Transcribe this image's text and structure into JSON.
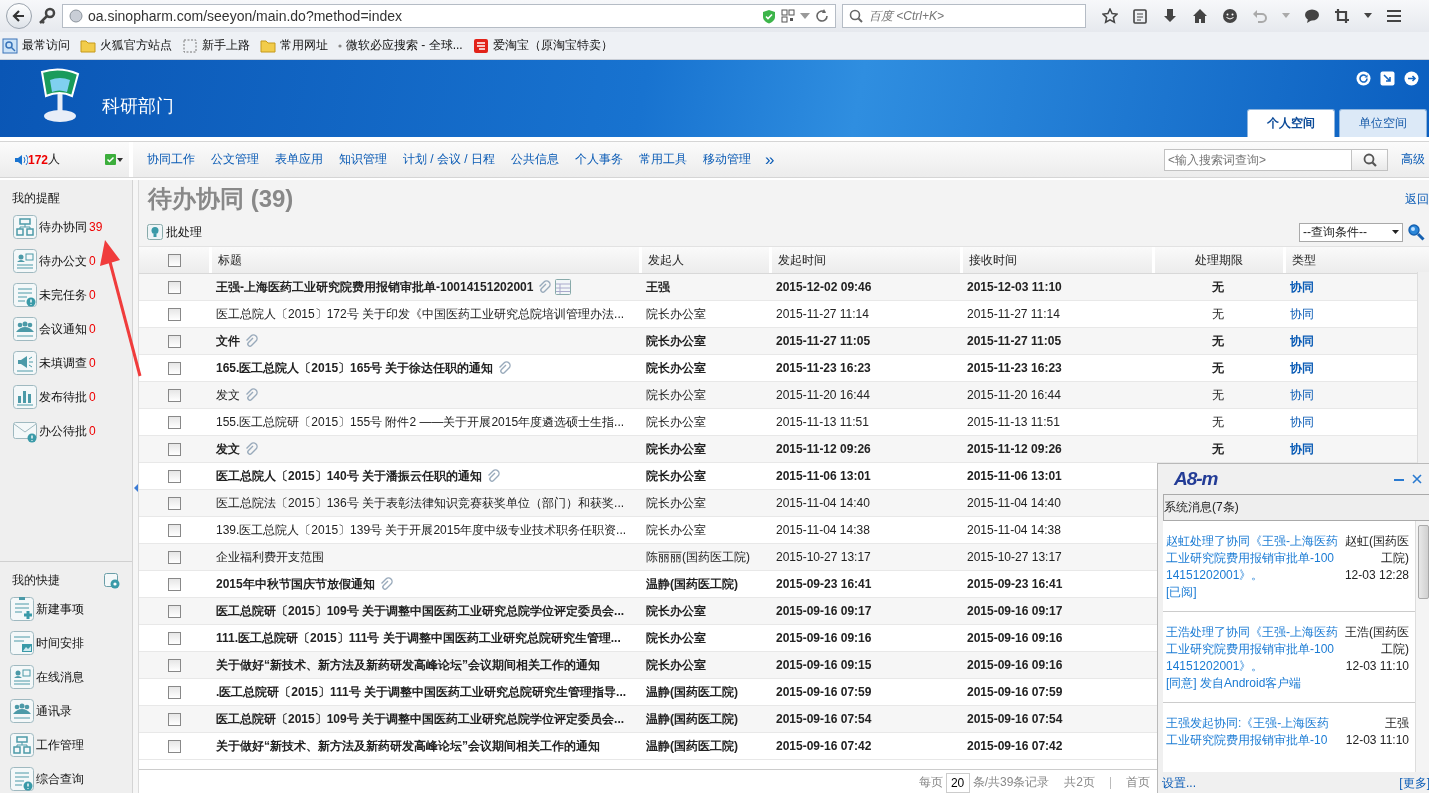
{
  "browser": {
    "url": "oa.sinopharm.com/seeyon/main.do?method=index",
    "search_placeholder": "百度 <Ctrl+K>",
    "bookmarks": [
      {
        "label": "最常访问",
        "kind": "recent"
      },
      {
        "label": "火狐官方站点",
        "kind": "folder"
      },
      {
        "label": "新手上路",
        "kind": "page"
      },
      {
        "label": "常用网址",
        "kind": "folder"
      },
      {
        "label": "微软必应搜索 - 全球...",
        "kind": "bing"
      },
      {
        "label": "爱淘宝（原淘宝特卖）",
        "kind": "shop"
      }
    ]
  },
  "header": {
    "title": "科研部门",
    "tabs": [
      {
        "label": "个人空间",
        "selected": true
      },
      {
        "label": "单位空间",
        "selected": false
      }
    ]
  },
  "navbar": {
    "online_count": "172",
    "online_unit": "人",
    "items": [
      "协同工作",
      "公文管理",
      "表单应用",
      "知识管理",
      "计划 / 会议 / 日程",
      "公共信息",
      "个人事务",
      "常用工具",
      "移动管理"
    ],
    "more": "»",
    "search_placeholder": "<输入搜索词查询>",
    "advanced": "高级"
  },
  "sidebar": {
    "reminders_title": "我的提醒",
    "reminders": [
      {
        "label": "待办协同",
        "count": "39"
      },
      {
        "label": "待办公文",
        "count": "0"
      },
      {
        "label": "未完任务",
        "count": "0"
      },
      {
        "label": "会议通知",
        "count": "0"
      },
      {
        "label": "未填调查",
        "count": "0"
      },
      {
        "label": "发布待批",
        "count": "0"
      },
      {
        "label": "办公待批",
        "count": "0"
      }
    ],
    "shortcuts_title": "我的快捷",
    "shortcuts": [
      "新建事项",
      "时间安排",
      "在线消息",
      "通讯录",
      "工作管理",
      "综合查询"
    ]
  },
  "main": {
    "title": "待办协同 (39)",
    "back": "返回",
    "batch": "批处理",
    "query_select": "--查询条件--"
  },
  "table": {
    "columns": [
      "标题",
      "发起人",
      "发起时间",
      "接收时间",
      "处理期限",
      "类型"
    ],
    "header_checked": false,
    "rows": [
      {
        "title": "王强-上海医药工业研究院费用报销审批单-10014151202001",
        "sender": "王强",
        "start": "2015-12-02 09:46",
        "received": "2015-12-03 11:10",
        "deadline": "无",
        "type": "协同",
        "unread": true,
        "attachment": true,
        "form": true,
        "checked": false
      },
      {
        "title": "医工总院人〔2015〕172号 关于印发《中国医药工业研究总院培训管理办法...",
        "sender": "院长办公室",
        "start": "2015-11-27 11:14",
        "received": "2015-11-27 11:14",
        "deadline": "无",
        "type": "协同",
        "unread": false,
        "attachment": false,
        "form": false,
        "checked": false
      },
      {
        "title": "文件",
        "sender": "院长办公室",
        "start": "2015-11-27 11:05",
        "received": "2015-11-27 11:05",
        "deadline": "无",
        "type": "协同",
        "unread": true,
        "attachment": true,
        "form": false,
        "checked": false
      },
      {
        "title": "165.医工总院人〔2015〕165号 关于徐达任职的通知",
        "sender": "院长办公室",
        "start": "2015-11-23 16:23",
        "received": "2015-11-23 16:23",
        "deadline": "无",
        "type": "协同",
        "unread": true,
        "attachment": true,
        "form": false,
        "checked": false
      },
      {
        "title": "发文",
        "sender": "院长办公室",
        "start": "2015-11-20 16:44",
        "received": "2015-11-20 16:44",
        "deadline": "无",
        "type": "协同",
        "unread": false,
        "attachment": true,
        "form": false,
        "checked": false
      },
      {
        "title": "155.医工总院研〔2015〕155号 附件2 ——关于开展2015年度遴选硕士生指...",
        "sender": "院长办公室",
        "start": "2015-11-13 11:51",
        "received": "2015-11-13 11:51",
        "deadline": "无",
        "type": "协同",
        "unread": false,
        "attachment": false,
        "form": false,
        "checked": false
      },
      {
        "title": "发文",
        "sender": "院长办公室",
        "start": "2015-11-12 09:26",
        "received": "2015-11-12 09:26",
        "deadline": "无",
        "type": "协同",
        "unread": true,
        "attachment": true,
        "form": false,
        "checked": false
      },
      {
        "title": "医工总院人〔2015〕140号 关于潘振云任职的通知",
        "sender": "院长办公室",
        "start": "2015-11-06 13:01",
        "received": "2015-11-06 13:01",
        "unread": true,
        "attachment": true,
        "form": false,
        "checked": false
      },
      {
        "title": "医工总院法〔2015〕136号 关于表彰法律知识竞赛获奖单位（部门）和获奖...",
        "sender": "院长办公室",
        "start": "2015-11-04 14:40",
        "received": "2015-11-04 14:40",
        "unread": false,
        "attachment": false,
        "form": false,
        "checked": false
      },
      {
        "title": "139.医工总院人〔2015〕139号 关于开展2015年度中级专业技术职务任职资...",
        "sender": "院长办公室",
        "start": "2015-11-04 14:38",
        "received": "2015-11-04 14:38",
        "unread": false,
        "attachment": false,
        "form": false,
        "checked": false
      },
      {
        "title": "企业福利费开支范围",
        "sender": "陈丽丽(国药医工院)",
        "start": "2015-10-27 13:17",
        "received": "2015-10-27 13:17",
        "unread": false,
        "attachment": false,
        "form": false,
        "checked": false
      },
      {
        "title": "2015年中秋节国庆节放假通知",
        "sender": "温静(国药医工院)",
        "start": "2015-09-23 16:41",
        "received": "2015-09-23 16:41",
        "unread": true,
        "attachment": true,
        "form": false,
        "checked": false
      },
      {
        "title": "医工总院研〔2015〕109号 关于调整中国医药工业研究总院学位评定委员会...",
        "sender": "院长办公室",
        "start": "2015-09-16 09:17",
        "received": "2015-09-16 09:17",
        "unread": true,
        "attachment": false,
        "form": false,
        "checked": false
      },
      {
        "title": "111.医工总院研〔2015〕111号 关于调整中国医药工业研究总院研究生管理...",
        "sender": "院长办公室",
        "start": "2015-09-16 09:16",
        "received": "2015-09-16 09:16",
        "unread": true,
        "attachment": false,
        "form": false,
        "checked": false
      },
      {
        "title": "关于做好“新技术、新方法及新药研发高峰论坛”会议期间相关工作的通知",
        "sender": "院长办公室",
        "start": "2015-09-16 09:15",
        "received": "2015-09-16 09:16",
        "unread": true,
        "attachment": false,
        "form": false,
        "checked": false
      },
      {
        "title": ".医工总院研〔2015〕111号 关于调整中国医药工业研究总院研究生管理指导...",
        "sender": "温静(国药医工院)",
        "start": "2015-09-16 07:59",
        "received": "2015-09-16 07:59",
        "unread": true,
        "attachment": false,
        "form": false,
        "checked": false
      },
      {
        "title": "医工总院研〔2015〕109号 关于调整中国医药工业研究总院学位评定委员会...",
        "sender": "温静(国药医工院)",
        "start": "2015-09-16 07:54",
        "received": "2015-09-16 07:54",
        "unread": true,
        "attachment": false,
        "form": false,
        "checked": false
      },
      {
        "title": "关于做好“新技术、新方法及新药研发高峰论坛”会议期间相关工作的通知",
        "sender": "温静(国药医工院)",
        "start": "2015-09-16 07:42",
        "received": "2015-09-16 07:42",
        "unread": true,
        "attachment": false,
        "form": false,
        "checked": false
      }
    ]
  },
  "pagination": {
    "per_page_label": "每页",
    "per_page": "20",
    "records": "条/共39条记录",
    "pages": "共2页",
    "first": "首页"
  },
  "popup": {
    "logo": "A8-m",
    "section": "系统消息(7条)",
    "messages": [
      {
        "text": "赵虹处理了协同《王强-上海医药工业研究院费用报销审批单-10014151202001》。",
        "status": "[已阅]",
        "sender": "赵虹(国药医工院)",
        "time": "12-03 12:28"
      },
      {
        "text": "王浩处理了协同《王强-上海医药工业研究院费用报销审批单-10014151202001》。",
        "status": "[同意] 发自Android客户端",
        "sender": "王浩(国药医工院)",
        "time": "12-03 11:10"
      },
      {
        "text": "王强发起协同:《王强-上海医药工业研究院费用报销审批单-10",
        "sender": "王强",
        "time": "12-03 11:10"
      }
    ],
    "settings": "设置...",
    "more": "[更多]"
  }
}
